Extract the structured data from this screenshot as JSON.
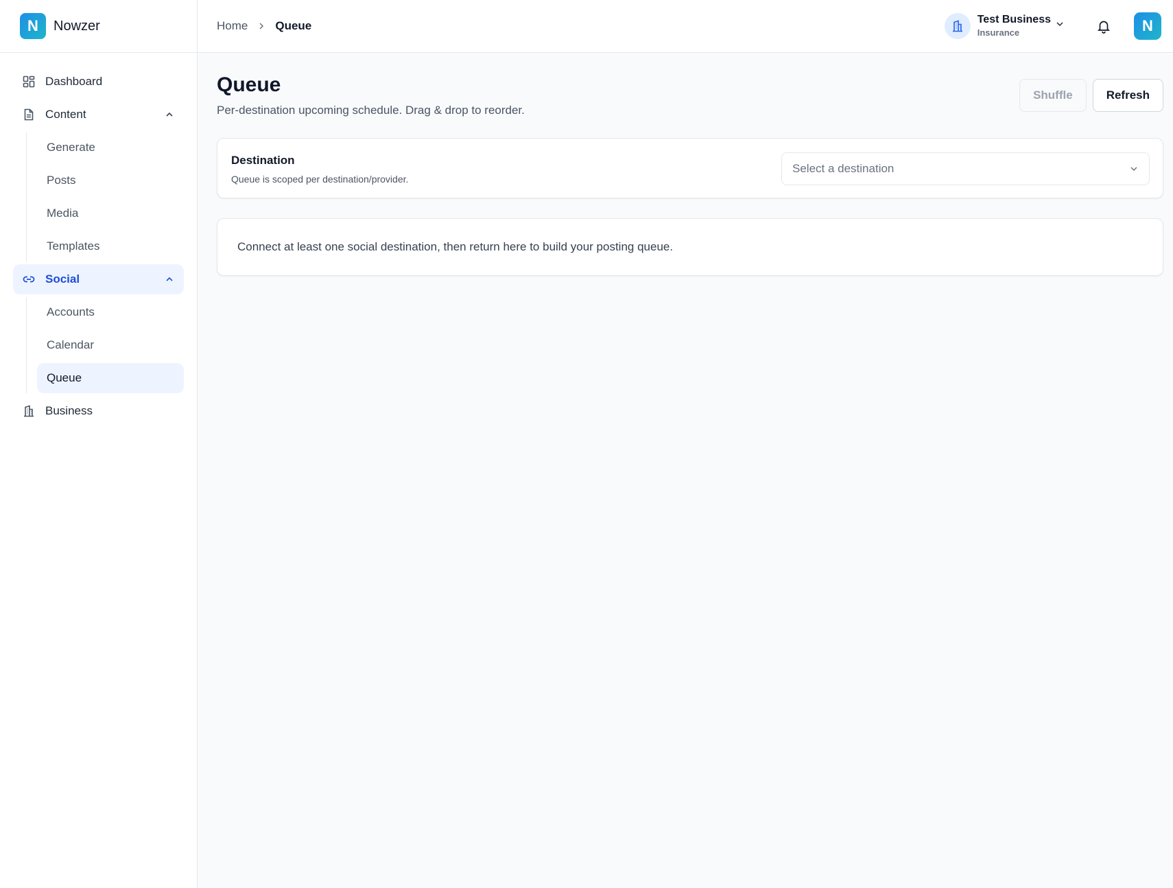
{
  "brand": {
    "logo_letter": "N",
    "name": "Nowzer"
  },
  "sidebar": {
    "items": [
      {
        "label": "Dashboard",
        "icon": "dashboard-icon"
      },
      {
        "label": "Content",
        "icon": "document-icon",
        "children": [
          "Generate",
          "Posts",
          "Media",
          "Templates"
        ]
      },
      {
        "label": "Social",
        "icon": "link-icon",
        "active": true,
        "children": [
          "Accounts",
          "Calendar",
          "Queue"
        ],
        "active_child": "Queue"
      },
      {
        "label": "Business",
        "icon": "building-icon"
      }
    ]
  },
  "topbar": {
    "breadcrumb": {
      "home": "Home",
      "current": "Queue"
    },
    "business": {
      "name": "Test Business",
      "category": "Insurance"
    },
    "avatar_letter": "N"
  },
  "page": {
    "title": "Queue",
    "subtitle": "Per-destination upcoming schedule. Drag & drop to reorder.",
    "actions": {
      "shuffle": "Shuffle",
      "refresh": "Refresh"
    },
    "destination": {
      "label": "Destination",
      "help": "Queue is scoped per destination/provider.",
      "placeholder": "Select a destination"
    },
    "empty_message": "Connect at least one social destination, then return here to build your posting queue."
  },
  "colors": {
    "accent": "#1d4ed8",
    "active_bg": "#eef4ff",
    "brand_gradient_start": "#1d8fe8",
    "brand_gradient_end": "#1fb5c9",
    "background": "#f8fafc"
  }
}
